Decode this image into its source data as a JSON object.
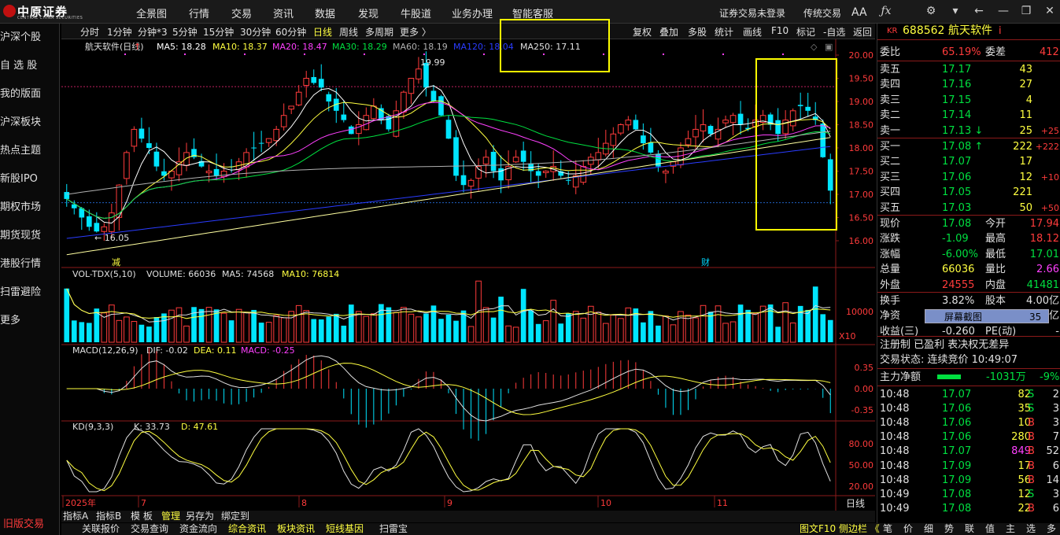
{
  "brand": {
    "name": "中原证券",
    "sub": "CENTRAL CHINA SECURITIES"
  },
  "topnav": [
    "全景图",
    "行情",
    "交易",
    "资讯",
    "数据",
    "发现",
    "牛股道",
    "业务办理",
    "智能客服"
  ],
  "topright": {
    "login": "证券交易未登录",
    "mode": "传统交易",
    "font": "AA"
  },
  "window_icons": [
    "fx-icon",
    "gear-icon",
    "shirt-icon",
    "back-arrow-icon",
    "minimize-icon",
    "restore-icon",
    "close-icon"
  ],
  "sidebar": {
    "items": [
      "沪深个股",
      "自 选 股",
      "我的版面",
      "沪深板块",
      "热点主题",
      "新股IPO",
      "期权市场",
      "期货现货",
      "港股行情",
      "扫雷避险",
      "更多"
    ],
    "bottom": "旧版交易"
  },
  "toolbar": {
    "periods": [
      "分时",
      "1分钟",
      "分钟*3",
      "5分钟",
      "15分钟",
      "30分钟",
      "60分钟",
      "日线",
      "周线",
      "多周期",
      "更多 〉"
    ],
    "active": "日线",
    "right": [
      "复权",
      "叠加",
      "多股",
      "统计",
      "画线",
      "F10",
      "标记",
      "-自选",
      "返回"
    ]
  },
  "main_legend": {
    "name": "航天软件(日线)",
    "ma5": "MA5: 18.28",
    "ma10": "MA10: 18.37",
    "ma20": "MA20: 18.47",
    "ma30": "MA30: 18.29",
    "ma60": "MA60: 18.19",
    "ma120": "MA120: 18.04",
    "ma250": "MA250: 17.11"
  },
  "annotations": {
    "high": "19.99",
    "low": "← 16.05",
    "reduce": "减",
    "fin": "财"
  },
  "vol_legend": {
    "name": "VOL-TDX(5,10)",
    "volume": "VOLUME: 66036",
    "ma5": "MA5: 74568",
    "ma10": "MA10: 76814",
    "unit": "X10"
  },
  "macd_legend": {
    "name": "MACD(12,26,9)",
    "dif": "DIF: -0.02",
    "dea": "DEA: 0.11",
    "macd": "MACD: -0.25"
  },
  "kd_legend": {
    "name": "KD(9,3,3)",
    "k": "K: 33.73",
    "d": "D: 47.61"
  },
  "axis": {
    "price_ticks": [
      "20.00",
      "19.50",
      "19.00",
      "18.50",
      "18.00",
      "17.50",
      "17.00",
      "16.50",
      "16.00"
    ],
    "vol_ticks": [
      "10000"
    ],
    "macd_ticks": [
      "0.35",
      "0.00",
      "-0.35"
    ],
    "kd_ticks": [
      "80.00",
      "50.00",
      "20.00"
    ],
    "months": [
      "2025年",
      "7",
      "8",
      "9",
      "10",
      "11"
    ],
    "period_label": "日线"
  },
  "bottom_tabs": [
    "指标A",
    "指标B",
    "模 板",
    "管理",
    "另存为",
    "绑定到"
  ],
  "bottom_active": "管理",
  "bottom_status": [
    "关联报价",
    "交易查询",
    "资金流向",
    "综合资讯",
    "板块资讯",
    "短线基因",
    "扫雷宝"
  ],
  "bottom_right": [
    "图文F10 侧边栏 《",
    "笔",
    "价",
    "细",
    "势",
    "联",
    "值",
    "主",
    "选",
    "多"
  ],
  "quote": {
    "prefix": "KR",
    "code": "688562",
    "name": "航天软件",
    "flag": "i",
    "weibi_label": "委比",
    "weibi": "65.19%",
    "weicha_label": "委差",
    "weicha": "412",
    "asks": [
      {
        "label": "卖五",
        "price": "17.17",
        "vol": "43",
        "chg": ""
      },
      {
        "label": "卖四",
        "price": "17.16",
        "vol": "27",
        "chg": ""
      },
      {
        "label": "卖三",
        "price": "17.15",
        "vol": "4",
        "chg": ""
      },
      {
        "label": "卖二",
        "price": "17.14",
        "vol": "11",
        "chg": ""
      },
      {
        "label": "卖一",
        "price": "17.13 ↓",
        "vol": "25",
        "chg": "+25"
      }
    ],
    "bids": [
      {
        "label": "买一",
        "price": "17.08 ↑",
        "vol": "222",
        "chg": "+222"
      },
      {
        "label": "买二",
        "price": "17.07",
        "vol": "17",
        "chg": ""
      },
      {
        "label": "买三",
        "price": "17.06",
        "vol": "12",
        "chg": "+10"
      },
      {
        "label": "买四",
        "price": "17.05",
        "vol": "221",
        "chg": ""
      },
      {
        "label": "买五",
        "price": "17.03",
        "vol": "50",
        "chg": "+50"
      }
    ],
    "stats": [
      {
        "l1": "现价",
        "v1": "17.08",
        "l2": "今开",
        "v2": "17.94"
      },
      {
        "l1": "涨跌",
        "v1": "-1.09",
        "l2": "最高",
        "v2": "18.12"
      },
      {
        "l1": "涨幅",
        "v1": "-6.00%",
        "l2": "最低",
        "v2": "17.01"
      },
      {
        "l1": "总量",
        "v1": "66036",
        "l2": "量比",
        "v2": "2.66"
      },
      {
        "l1": "外盘",
        "v1": "24555",
        "l2": "内盘",
        "v2": "41481"
      }
    ],
    "stats2": [
      {
        "l1": "换手",
        "v1": "3.82%",
        "l2": "股本",
        "v2": "4.00亿"
      },
      {
        "l1": "净资",
        "v1": "",
        "l2": "",
        "v2": "4.00亿"
      },
      {
        "l1": "收益(三)",
        "v1": "-0.260",
        "l2": "PE(动)",
        "v2": "-"
      }
    ],
    "screenshot_popup": {
      "label": "屏幕截图",
      "count": "35"
    },
    "reg": "注册制  已盈利  表决权无差异",
    "status": "交易状态: 连续竞价 10:49:07",
    "mainflow_label": "主力净额",
    "mainflow_value": "-1031万",
    "mainflow_pct": "-9%",
    "ticks": [
      {
        "t": "10:48",
        "p": "17.07",
        "v": "82",
        "s": "S",
        "n": "2"
      },
      {
        "t": "10:48",
        "p": "17.06",
        "v": "35",
        "s": "S",
        "n": "3"
      },
      {
        "t": "10:48",
        "p": "17.06",
        "v": "10",
        "s": "B",
        "n": "3"
      },
      {
        "t": "10:48",
        "p": "17.06",
        "v": "280",
        "s": "B",
        "n": "7"
      },
      {
        "t": "10:48",
        "p": "17.07",
        "v": "849",
        "s": "B",
        "n": "52"
      },
      {
        "t": "10:48",
        "p": "17.09",
        "v": "17",
        "s": "B",
        "n": "6"
      },
      {
        "t": "10:48",
        "p": "17.09",
        "v": "56",
        "s": "B",
        "n": "14"
      },
      {
        "t": "10:49",
        "p": "17.08",
        "v": "12",
        "s": "S",
        "n": "3"
      },
      {
        "t": "10:49",
        "p": "17.08",
        "v": "22",
        "s": "B",
        "n": "6"
      }
    ]
  },
  "colors": {
    "up": "#ff3b3b",
    "down": "#00e5ff",
    "ma5": "#ffffff",
    "ma10": "#ffff40",
    "ma20": "#ff40ff",
    "ma30": "#00e040",
    "ma60": "#b0b0b0",
    "ma120": "#2a3cff",
    "ma250": "#ffffa0"
  },
  "chart_data": {
    "type": "candlestick",
    "x": [
      "2025-06-20",
      "2025-11-20"
    ],
    "price_range": [
      16.0,
      20.0
    ],
    "closes": [
      16.9,
      16.7,
      16.5,
      16.3,
      16.2,
      16.3,
      16.6,
      17.2,
      17.9,
      18.4,
      18.2,
      18.0,
      17.6,
      17.4,
      17.5,
      17.7,
      17.9,
      17.8,
      17.6,
      17.5,
      17.4,
      17.5,
      17.6,
      17.7,
      17.9,
      18.0,
      18.1,
      18.2,
      18.4,
      18.7,
      18.9,
      19.2,
      19.5,
      19.4,
      19.3,
      19.0,
      18.8,
      18.6,
      18.3,
      18.5,
      18.7,
      18.9,
      18.6,
      18.4,
      18.8,
      19.2,
      19.5,
      19.7,
      19.3,
      19.0,
      18.7,
      18.2,
      17.4,
      17.2,
      17.3,
      17.6,
      17.8,
      17.5,
      17.3,
      17.6,
      17.8,
      17.7,
      17.5,
      17.4,
      17.5,
      17.6,
      17.4,
      17.3,
      17.4,
      17.6,
      17.8,
      17.9,
      18.1,
      18.3,
      18.5,
      18.6,
      18.4,
      18.1,
      17.9,
      17.6,
      17.5,
      17.7,
      18.0,
      18.2,
      18.4,
      18.5,
      18.3,
      18.4,
      18.6,
      18.7,
      18.5,
      18.4,
      18.6,
      18.7,
      18.5,
      18.3,
      18.6,
      18.8,
      18.9,
      18.8,
      18.6,
      17.8,
      17.08
    ]
  }
}
